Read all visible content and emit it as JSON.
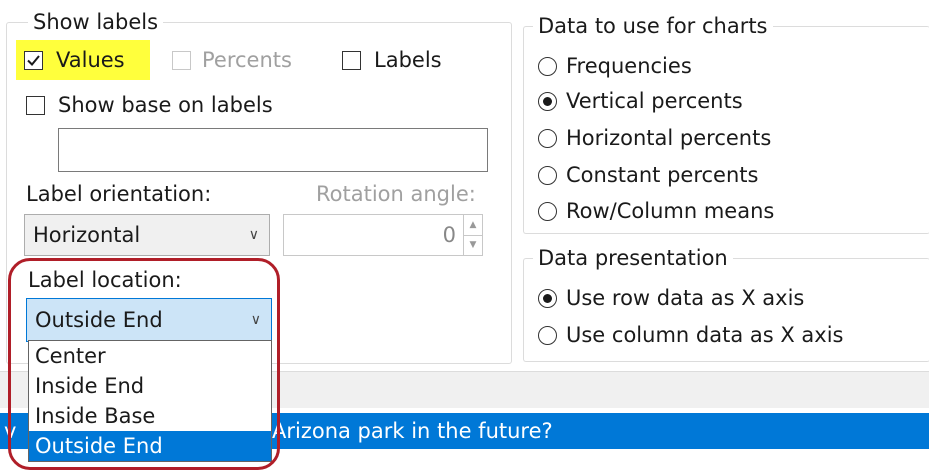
{
  "show_labels": {
    "title": "Show labels",
    "values": {
      "label": "Values",
      "checked": true
    },
    "percents": {
      "label": "Percents",
      "checked": false,
      "disabled": true
    },
    "labels": {
      "label": "Labels",
      "checked": false
    },
    "show_base": {
      "label": "Show base on labels",
      "checked": false
    },
    "base_text_value": "",
    "label_orientation_label": "Label orientation:",
    "rotation_angle_label": "Rotation angle:",
    "orientation_value": "Horizontal",
    "rotation_value": "0",
    "label_location_label": "Label location:",
    "location_value": "Outside End",
    "location_options": [
      "Center",
      "Inside End",
      "Inside Base",
      "Outside End"
    ],
    "location_selected": "Outside End"
  },
  "data_for_charts": {
    "title": "Data to use for charts",
    "options": [
      "Frequencies",
      "Vertical percents",
      "Horizontal percents",
      "Constant percents",
      "Row/Column means"
    ],
    "selected": "Vertical percents"
  },
  "data_presentation": {
    "title": "Data presentation",
    "options": [
      "Use row data as X axis",
      "Use column data as X axis"
    ],
    "selected": "Use row data as X axis"
  },
  "background_row_text": "Arizona park in the future?",
  "colors": {
    "highlight": "#ffff3c",
    "callout": "#b01e28",
    "selection": "#0078d7"
  }
}
